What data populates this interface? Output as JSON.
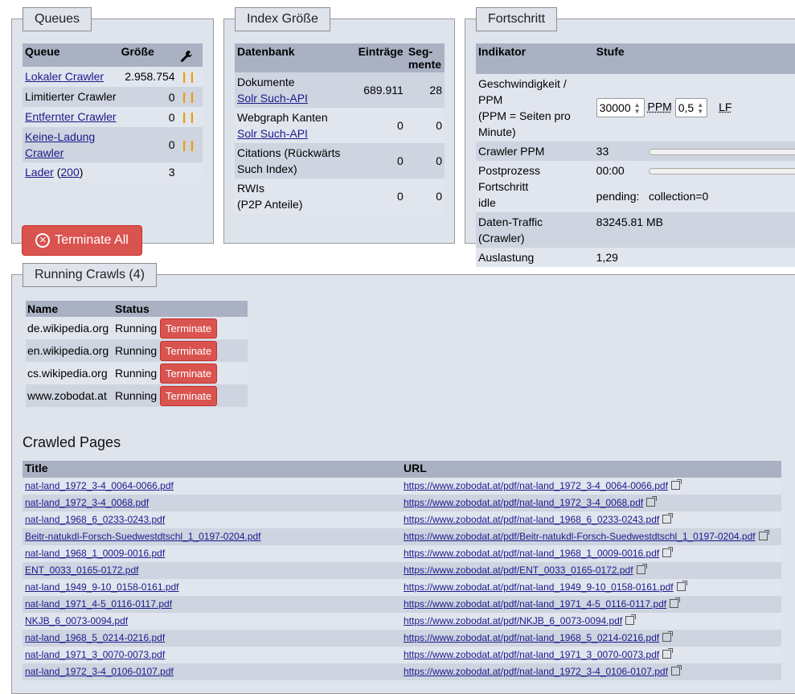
{
  "queues": {
    "legend": "Queues",
    "headers": [
      "Queue",
      "Größe"
    ],
    "rows": [
      {
        "name": "Lokaler Crawler",
        "link": true,
        "size": "2.958.754",
        "paused": true
      },
      {
        "name": "Limitierter Crawler",
        "link": false,
        "size": "0",
        "paused": true
      },
      {
        "name": "Entfernter Crawler",
        "link": true,
        "size": "0",
        "paused": true
      },
      {
        "name": "Keine-Ladung Crawler",
        "link": true,
        "size": "0",
        "paused": true
      },
      {
        "name": "Lader",
        "extra": "200",
        "link": true,
        "size": "3",
        "paused": false
      }
    ],
    "terminate_all": "Terminate All"
  },
  "index": {
    "legend": "Index Größe",
    "headers": [
      "Datenbank",
      "Einträge",
      "Seg-mente"
    ],
    "rows": [
      {
        "name": "Dokumente",
        "sub": "Solr Such-API",
        "entries": "689.911",
        "segments": "28"
      },
      {
        "name": "Webgraph Kanten",
        "sub": "Solr Such-API",
        "entries": "0",
        "segments": "0"
      },
      {
        "name": "Citations (Rückwärts Such Index)",
        "sub": "",
        "entries": "0",
        "segments": "0"
      },
      {
        "name": "RWIs",
        "sub": "(P2P Anteile)",
        "entries": "0",
        "segments": "0"
      }
    ]
  },
  "progress": {
    "legend": "Fortschritt",
    "headers": [
      "Indikator",
      "Stufe"
    ],
    "speed_label": "Geschwindigkeit / PPM",
    "speed_sub": "(PPM = Seiten pro Minute)",
    "ppm_value": "30000",
    "ppm_unit": "PPM",
    "lf_value": "0,5",
    "lf_unit": "LF",
    "crawler_ppm_label": "Crawler PPM",
    "crawler_ppm_value": "33",
    "postprocess_label": "Postprozess Fortschritt",
    "postprocess_state": "idle",
    "postprocess_time": "00:00",
    "pending_label": "pending:",
    "pending_value": "collection=0",
    "traffic_label": "Daten-Traffic (Crawler)",
    "traffic_value": "83245.81 MB",
    "load_label": "Auslastung",
    "load_value": "1,29"
  },
  "running": {
    "legend": "Running Crawls (4)",
    "headers": [
      "Name",
      "Status"
    ],
    "status_text": "Running",
    "button_label": "Terminate",
    "rows": [
      "de.wikipedia.org",
      "en.wikipedia.org",
      "cs.wikipedia.org",
      "www.zobodat.at"
    ]
  },
  "crawled": {
    "title": "Crawled Pages",
    "headers": [
      "Title",
      "URL"
    ],
    "rows": [
      {
        "title": "nat-land_1972_3-4_0064-0066.pdf",
        "url": "https://www.zobodat.at/pdf/nat-land_1972_3-4_0064-0066.pdf"
      },
      {
        "title": "nat-land_1972_3-4_0068.pdf",
        "url": "https://www.zobodat.at/pdf/nat-land_1972_3-4_0068.pdf"
      },
      {
        "title": "nat-land_1968_6_0233-0243.pdf",
        "url": "https://www.zobodat.at/pdf/nat-land_1968_6_0233-0243.pdf"
      },
      {
        "title": "Beitr-natukdl-Forsch-Suedwestdtschl_1_0197-0204.pdf",
        "url": "https://www.zobodat.at/pdf/Beitr-natukdl-Forsch-Suedwestdtschl_1_0197-0204.pdf"
      },
      {
        "title": "nat-land_1968_1_0009-0016.pdf",
        "url": "https://www.zobodat.at/pdf/nat-land_1968_1_0009-0016.pdf"
      },
      {
        "title": "ENT_0033_0165-0172.pdf",
        "url": "https://www.zobodat.at/pdf/ENT_0033_0165-0172.pdf"
      },
      {
        "title": "nat-land_1949_9-10_0158-0161.pdf",
        "url": "https://www.zobodat.at/pdf/nat-land_1949_9-10_0158-0161.pdf"
      },
      {
        "title": "nat-land_1971_4-5_0116-0117.pdf",
        "url": "https://www.zobodat.at/pdf/nat-land_1971_4-5_0116-0117.pdf"
      },
      {
        "title": "NKJB_6_0073-0094.pdf",
        "url": "https://www.zobodat.at/pdf/NKJB_6_0073-0094.pdf"
      },
      {
        "title": "nat-land_1968_5_0214-0216.pdf",
        "url": "https://www.zobodat.at/pdf/nat-land_1968_5_0214-0216.pdf"
      },
      {
        "title": "nat-land_1971_3_0070-0073.pdf",
        "url": "https://www.zobodat.at/pdf/nat-land_1971_3_0070-0073.pdf"
      },
      {
        "title": "nat-land_1972_3-4_0106-0107.pdf",
        "url": "https://www.zobodat.at/pdf/nat-land_1972_3-4_0106-0107.pdf"
      }
    ]
  }
}
